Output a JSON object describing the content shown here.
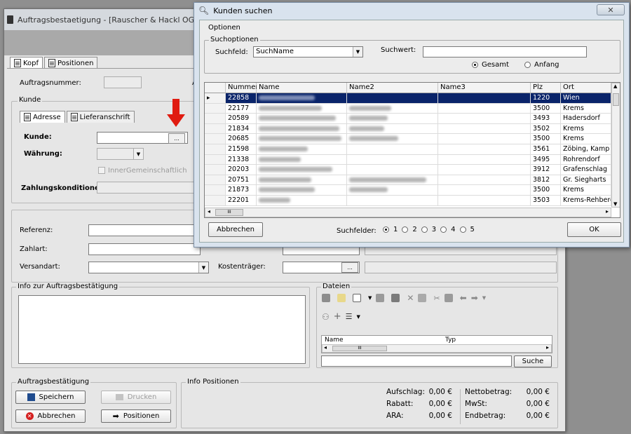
{
  "main": {
    "title": "Auftragsbestaetigung - [Rauscher & Hackl OG]",
    "tabs": [
      "Kopf",
      "Positionen"
    ],
    "auftragsnummer_label": "Auftragsnummer:",
    "a_label": "A",
    "kunde_group": "Kunde",
    "kunde_tabs": [
      "Adresse",
      "Lieferanschrift"
    ],
    "kunde_label": "Kunde:",
    "waehrung_label": "Währung:",
    "inner_label": "InnerGemeinschaftlich",
    "zahlungskond_label": "Zahlungskonditionen:",
    "referenz_label": "Referenz:",
    "zahlart_label": "Zahlart:",
    "versandart_label": "Versandart:",
    "kostentraeger_label": "Kostenträger:",
    "info_group": "Info zur Auftragsbestätigung",
    "dateien_group": "Dateien",
    "dateien_cols": [
      "Name",
      "Typ"
    ],
    "dateien_scroll": "III",
    "suche_button": "Suche",
    "ab_group": "Auftragsbestätigung",
    "buttons": {
      "speichern": "Speichern",
      "drucken": "Drucken",
      "abbrechen": "Abbrechen",
      "positionen": "Positionen"
    },
    "infopos_group": "Info Positionen",
    "totals": [
      {
        "label": "Aufschlag:",
        "value": "0,00 €"
      },
      {
        "label": "Rabatt:",
        "value": "0,00 €"
      },
      {
        "label": "ARA:",
        "value": "0,00 €"
      }
    ],
    "totals2": [
      {
        "label": "Nettobetrag:",
        "value": "0,00 €"
      },
      {
        "label": "MwSt:",
        "value": "0,00 €"
      },
      {
        "label": "Endbetrag:",
        "value": "0,00 €"
      }
    ]
  },
  "dialog": {
    "title": "Kunden suchen",
    "close": "✕",
    "optionen_tab": "Optionen",
    "suchoptionen_group": "Suchoptionen",
    "suchfeld_label": "Suchfeld:",
    "suchfeld_value": "SuchName",
    "suchwert_label": "Suchwert:",
    "suchwert_value": "",
    "radio_gesamt": "Gesamt",
    "radio_anfang": "Anfang",
    "columns": [
      "Nummer",
      "Name",
      "Name2",
      "Name3",
      "Plz",
      "Ort"
    ],
    "rows": [
      {
        "nummer": "22858",
        "plz": "1220",
        "ort": "Wien",
        "n1": 80,
        "n2": 0
      },
      {
        "nummer": "22177",
        "plz": "3500",
        "ort": "Krems",
        "n1": 90,
        "n2": 60
      },
      {
        "nummer": "20589",
        "plz": "3493",
        "ort": "Hadersdorf",
        "n1": 110,
        "n2": 55
      },
      {
        "nummer": "21834",
        "plz": "3502",
        "ort": "Krems",
        "n1": 115,
        "n2": 50
      },
      {
        "nummer": "20685",
        "plz": "3500",
        "ort": "Krems",
        "n1": 118,
        "n2": 70
      },
      {
        "nummer": "21598",
        "plz": "3561",
        "ort": "Zöbing, Kamp",
        "n1": 70,
        "n2": 0
      },
      {
        "nummer": "21338",
        "plz": "3495",
        "ort": "Rohrendorf",
        "n1": 60,
        "n2": 0
      },
      {
        "nummer": "20203",
        "plz": "3912",
        "ort": "Grafenschlag",
        "n1": 105,
        "n2": 0
      },
      {
        "nummer": "20751",
        "plz": "3812",
        "ort": "Gr. Siegharts",
        "n1": 75,
        "n2": 110
      },
      {
        "nummer": "21873",
        "plz": "3500",
        "ort": "Krems",
        "n1": 80,
        "n2": 55
      },
      {
        "nummer": "22201",
        "plz": "3503",
        "ort": "Krems-Rehberg",
        "n1": 45,
        "n2": 0
      }
    ],
    "abbrechen": "Abbrechen",
    "suchfelder_label": "Suchfelder:",
    "suchfelder_options": [
      "1",
      "2",
      "3",
      "4",
      "5"
    ],
    "ok": "OK",
    "scroll_grip": "III"
  }
}
